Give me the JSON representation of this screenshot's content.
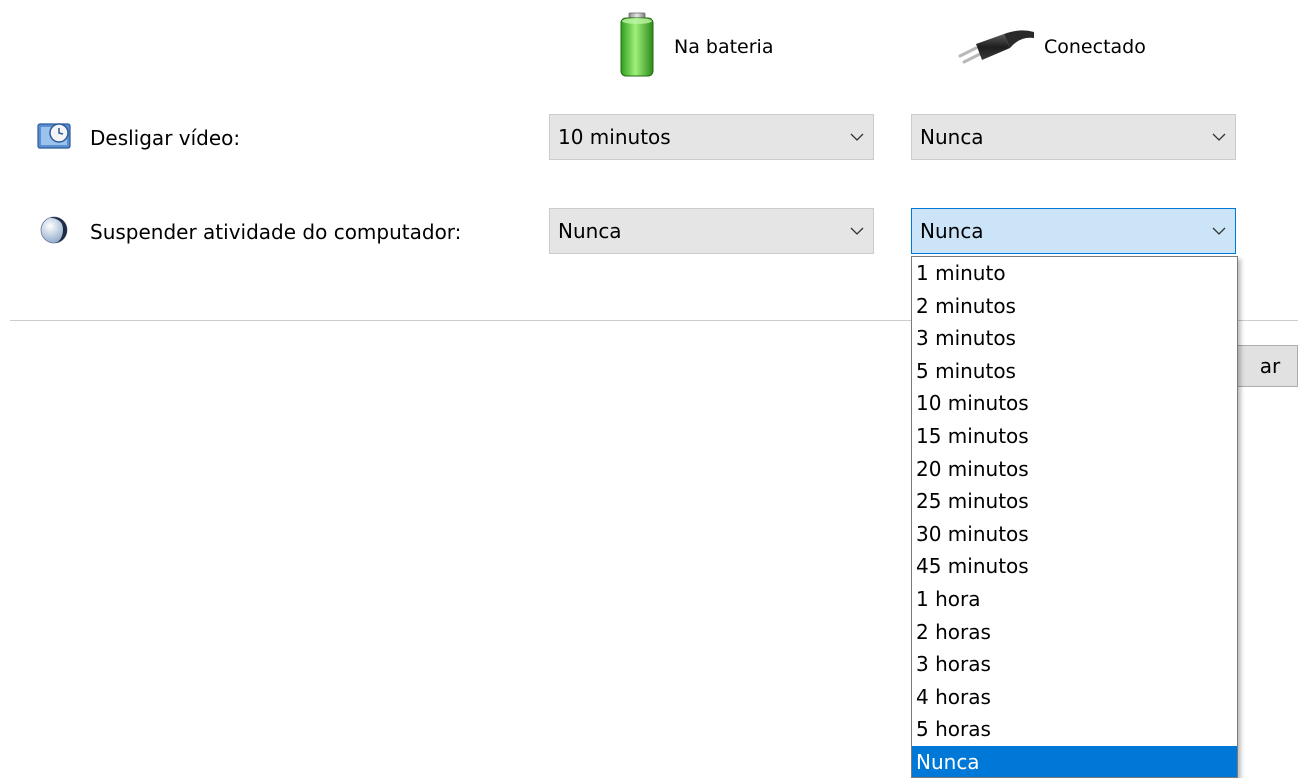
{
  "headers": {
    "battery_label": "Na bateria",
    "plugged_label": "Conectado",
    "battery_icon": "battery-icon",
    "plug_icon": "plug-icon"
  },
  "rows": [
    {
      "label": "Desligar vídeo:",
      "icon": "display-timer-icon",
      "battery_value": "10 minutos",
      "plugged_value": "Nunca"
    },
    {
      "label": "Suspender atividade do computador:",
      "icon": "sleep-moon-icon",
      "battery_value": "Nunca",
      "plugged_value": "Nunca"
    }
  ],
  "dropdown": {
    "options": [
      "1 minuto",
      "2 minutos",
      "3 minutos",
      "5 minutos",
      "10 minutos",
      "15 minutos",
      "20 minutos",
      "25 minutos",
      "30 minutos",
      "45 minutos",
      "1 hora",
      "2 horas",
      "3 horas",
      "4 horas",
      "5 horas",
      "Nunca"
    ],
    "selected": "Nunca"
  },
  "hidden_button_label": "ar",
  "colors": {
    "accent": "#0078d7",
    "focused_bg": "#cce4f7",
    "combo_bg": "#e5e5e5",
    "battery_green": "#3fb618"
  }
}
